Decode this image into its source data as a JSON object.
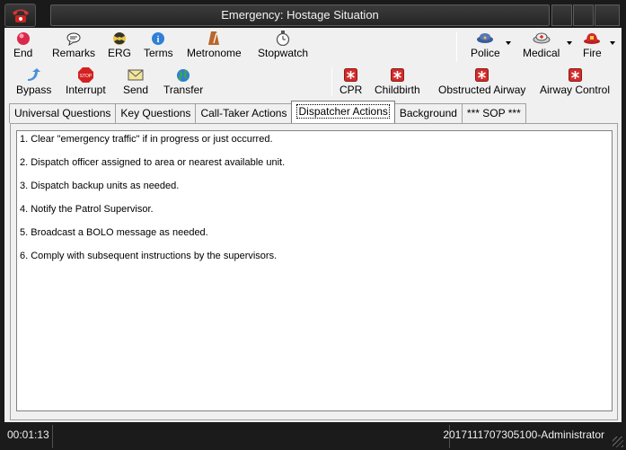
{
  "window": {
    "title": "Emergency: Hostage Situation"
  },
  "toolbar_row1": {
    "end": "End",
    "remarks": "Remarks",
    "erg": "ERG",
    "terms": "Terms",
    "metronome": "Metronome",
    "stopwatch": "Stopwatch",
    "police": "Police",
    "medical": "Medical",
    "fire": "Fire"
  },
  "toolbar_row2": {
    "bypass": "Bypass",
    "interrupt": "Interrupt",
    "send": "Send",
    "transfer": "Transfer",
    "cpr": "CPR",
    "childbirth": "Childbirth",
    "obstructed_airway": "Obstructed Airway",
    "airway_control": "Airway Control"
  },
  "tabs": {
    "universal_questions": "Universal Questions",
    "key_questions": "Key Questions",
    "call_taker_actions": "Call-Taker Actions",
    "dispatcher_actions": "Dispatcher Actions",
    "background": "Background",
    "sop": "*** SOP ***"
  },
  "content": {
    "items": [
      "1.  Clear \"emergency traffic\" if in progress or just occurred.",
      "2.  Dispatch officer assigned to area or nearest available unit.",
      "3.  Dispatch backup units as needed.",
      "4.  Notify the Patrol Supervisor.",
      "5.  Broadcast a BOLO message as needed.",
      "6.  Comply with subsequent instructions by the supervisors."
    ]
  },
  "status": {
    "timer": "00:01:13",
    "session": "2017111707305100-Administrator"
  },
  "colors": {
    "chrome": "#1b1b1b",
    "panel": "#f0f0f0",
    "emergency_red": "#d32b2b"
  }
}
